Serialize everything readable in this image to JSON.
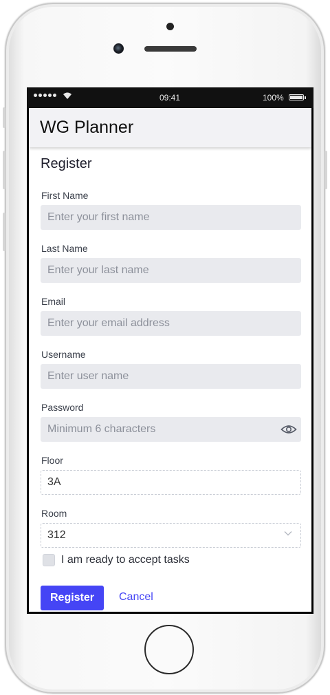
{
  "status_bar": {
    "time": "09:41",
    "battery": "100%"
  },
  "app": {
    "title": "WG Planner"
  },
  "form": {
    "heading": "Register",
    "first_name": {
      "label": "First Name",
      "placeholder": "Enter your first name"
    },
    "last_name": {
      "label": "Last Name",
      "placeholder": "Enter your last name"
    },
    "email": {
      "label": "Email",
      "placeholder": "Enter your email address"
    },
    "username": {
      "label": "Username",
      "placeholder": "Enter user name"
    },
    "password": {
      "label": "Password",
      "placeholder": "Minimum 6 characters",
      "toggle_icon": "eye-icon"
    },
    "floor": {
      "label": "Floor",
      "value": "3A"
    },
    "room": {
      "label": "Room",
      "value": "312",
      "icon": "chevron-down-icon"
    },
    "accept_tasks": {
      "label": "I am ready to accept tasks",
      "checked": false
    },
    "register_label": "Register",
    "cancel_label": "Cancel"
  },
  "colors": {
    "accent": "#4545f5",
    "field_bg": "#e9eaee",
    "appbar_bg": "#f2f2f5"
  }
}
